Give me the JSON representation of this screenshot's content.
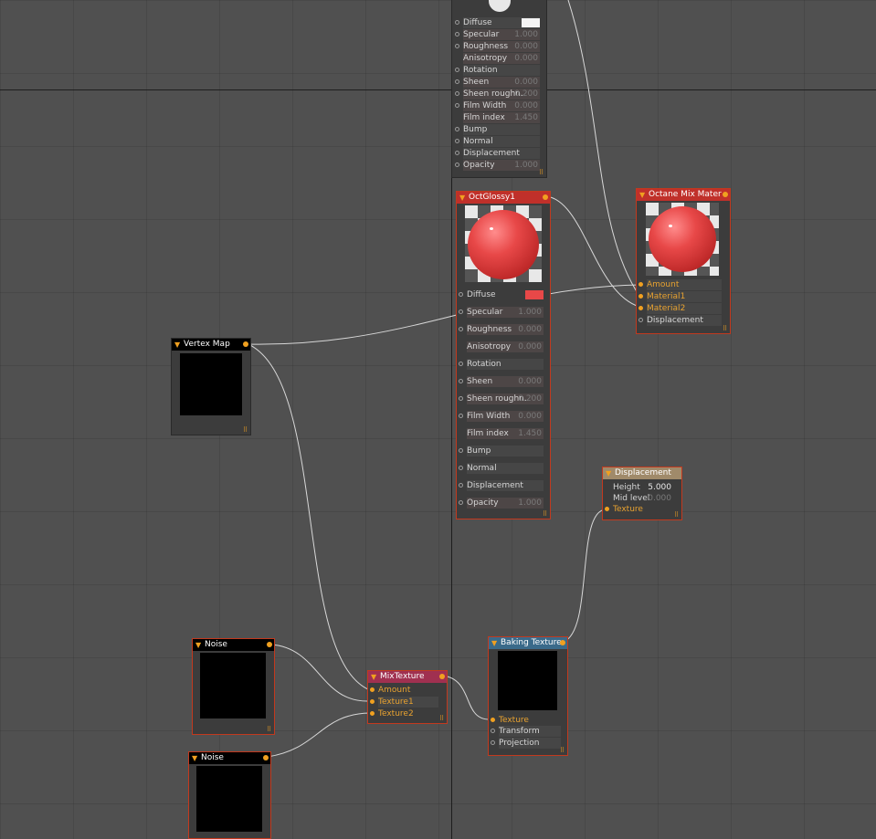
{
  "canvas": {
    "background": "#505050"
  },
  "colors": {
    "selected_border": "#c2391e",
    "pin_active": "#f0a020",
    "wire": "#d8d8d8"
  },
  "icons": {
    "collapse": "triangle-down-icon",
    "output": "output-pin-icon",
    "resize": "resize-grip-icon"
  },
  "top_material": {
    "header_color": "#3c3c3c",
    "params": [
      {
        "label": "Diffuse",
        "value": ""
      },
      {
        "label": "Specular",
        "value": "1.000"
      },
      {
        "label": "Roughness",
        "value": "0.000"
      },
      {
        "label": "Anisotropy",
        "value": "0.000"
      },
      {
        "label": "Rotation",
        "value": ""
      },
      {
        "label": "Sheen",
        "value": "0.000"
      },
      {
        "label": "Sheen roughn.",
        "value": "0.200"
      },
      {
        "label": "Film Width",
        "value": "0.000"
      },
      {
        "label": "Film index",
        "value": "1.450"
      },
      {
        "label": "Bump",
        "value": ""
      },
      {
        "label": "Normal",
        "value": ""
      },
      {
        "label": "Displacement",
        "value": ""
      },
      {
        "label": "Opacity",
        "value": "1.000"
      }
    ]
  },
  "oct_glossy": {
    "title": "OctGlossy1",
    "header_color": "#c0302a",
    "diffuse_color": "#e84848",
    "params": [
      {
        "label": "Diffuse",
        "value": ""
      },
      {
        "label": "Specular",
        "value": "1.000"
      },
      {
        "label": "Roughness",
        "value": "0.000"
      },
      {
        "label": "Anisotropy",
        "value": "0.000"
      },
      {
        "label": "Rotation",
        "value": ""
      },
      {
        "label": "Sheen",
        "value": "0.000"
      },
      {
        "label": "Sheen roughn.",
        "value": "0.200"
      },
      {
        "label": "Film Width",
        "value": "0.000"
      },
      {
        "label": "Film index",
        "value": "1.450"
      },
      {
        "label": "Bump",
        "value": ""
      },
      {
        "label": "Normal",
        "value": ""
      },
      {
        "label": "Displacement",
        "value": ""
      },
      {
        "label": "Opacity",
        "value": "1.000"
      }
    ]
  },
  "mix_material": {
    "title": "Octane Mix Mater",
    "header_color": "#c0302a",
    "inputs": [
      "Amount",
      "Material1",
      "Material2",
      "Displacement"
    ]
  },
  "vertex_map": {
    "title": "Vertex Map",
    "header_color": "#000000"
  },
  "displacement": {
    "title": "Displacement",
    "header_color": "#a08a6a",
    "params": [
      {
        "label": "Height",
        "value": "5.000"
      },
      {
        "label": "Mid level",
        "value": "0.000"
      }
    ],
    "inputs": [
      "Texture"
    ]
  },
  "noise1": {
    "title": "Noise",
    "header_color": "#000000"
  },
  "noise2": {
    "title": "Noise",
    "header_color": "#000000"
  },
  "mix_texture": {
    "title": "MixTexture",
    "header_color": "#a03050",
    "inputs": [
      "Amount",
      "Texture1",
      "Texture2"
    ]
  },
  "baking_texture": {
    "title": "Baking Texture",
    "header_color": "#3a6a8a",
    "inputs": [
      "Texture",
      "Transform",
      "Projection"
    ]
  }
}
